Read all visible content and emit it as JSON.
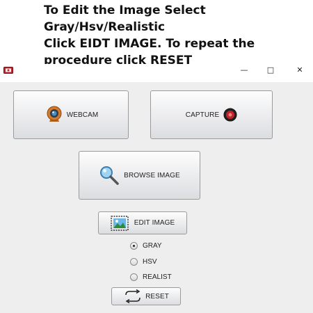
{
  "instructions": {
    "line1": "To Edit the Image Select",
    "line2": "Gray/Hsv/Realistic",
    "line3": "Click EIDT IMAGE.  To repeat the",
    "line4": "procedure click RESET"
  },
  "window": {
    "controls": {
      "minimize": "—",
      "maximize": "□",
      "close": "✕"
    }
  },
  "buttons": {
    "webcam": {
      "label": "WEBCAM",
      "icon": "webcam-icon"
    },
    "capture": {
      "label": "CAPTURE",
      "icon": "record-icon"
    },
    "browse": {
      "label": "BROWSE IMAGE",
      "icon": "magnifier-icon"
    },
    "edit": {
      "label": "EDIT IMAGE",
      "icon": "landscape-image-icon"
    },
    "reset": {
      "label": "RESET",
      "icon": "refresh-arrows-icon"
    }
  },
  "modes": {
    "options": [
      {
        "label": "GRAY",
        "selected": true
      },
      {
        "label": "HSV",
        "selected": false
      },
      {
        "label": "REALIST",
        "selected": false
      }
    ]
  },
  "colors": {
    "accent": "#c0242b",
    "client_bg": "#eeeeee"
  }
}
